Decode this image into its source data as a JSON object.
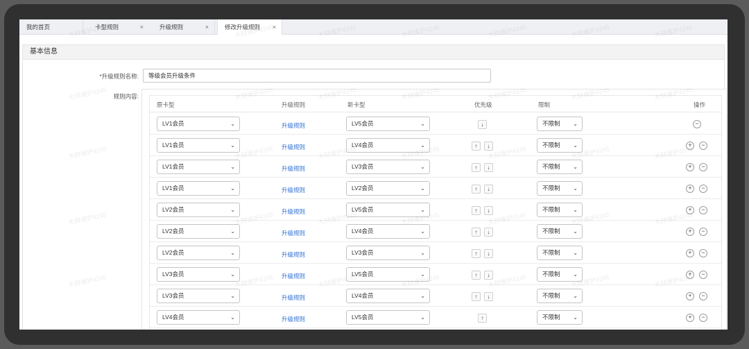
{
  "tabs": [
    {
      "label": "我的首页",
      "closable": false
    },
    {
      "label": "卡型规则",
      "closable": true
    },
    {
      "label": "升级规则",
      "closable": true
    },
    {
      "label": "修改升级规则",
      "closable": true,
      "active": true
    }
  ],
  "tab_close_glyph": "×",
  "section_title": "基本信息",
  "form": {
    "name_label": "*升级规则名称:",
    "name_value": "等级会员升级条件",
    "content_label": "规则内容:"
  },
  "table": {
    "headers": {
      "original_card": "原卡型",
      "upgrade_rule": "升级规则",
      "new_card": "新卡型",
      "priority": "优先级",
      "limit": "限制",
      "action": "操作"
    },
    "rows": [
      {
        "from": "LV1会员",
        "rule": "升级规则",
        "to": "LV5会员",
        "limit": "不限制",
        "up": false,
        "down": true,
        "add": false,
        "remove": true
      },
      {
        "from": "LV1会员",
        "rule": "升级规则",
        "to": "LV4会员",
        "limit": "不限制",
        "up": true,
        "down": true,
        "add": true,
        "remove": true
      },
      {
        "from": "LV1会员",
        "rule": "升级规则",
        "to": "LV3会员",
        "limit": "不限制",
        "up": true,
        "down": true,
        "add": true,
        "remove": true
      },
      {
        "from": "LV1会员",
        "rule": "升级规则",
        "to": "LV2会员",
        "limit": "不限制",
        "up": true,
        "down": true,
        "add": true,
        "remove": true
      },
      {
        "from": "LV2会员",
        "rule": "升级规则",
        "to": "LV5会员",
        "limit": "不限制",
        "up": true,
        "down": true,
        "add": true,
        "remove": true
      },
      {
        "from": "LV2会员",
        "rule": "升级规则",
        "to": "LV4会员",
        "limit": "不限制",
        "up": true,
        "down": true,
        "add": true,
        "remove": true
      },
      {
        "from": "LV2会员",
        "rule": "升级规则",
        "to": "LV3会员",
        "limit": "不限制",
        "up": true,
        "down": true,
        "add": true,
        "remove": true
      },
      {
        "from": "LV3会员",
        "rule": "升级规则",
        "to": "LV5会员",
        "limit": "不限制",
        "up": true,
        "down": true,
        "add": true,
        "remove": true
      },
      {
        "from": "LV3会员",
        "rule": "升级规则",
        "to": "LV4会员",
        "limit": "不限制",
        "up": true,
        "down": true,
        "add": true,
        "remove": true
      },
      {
        "from": "LV4会员",
        "rule": "升级规则",
        "to": "LV5会员",
        "limit": "不限制",
        "up": true,
        "down": false,
        "add": true,
        "remove": true
      }
    ]
  },
  "glyphs": {
    "up": "↑",
    "down": "↓",
    "add": "+",
    "remove": "−",
    "chevron": "⌄"
  },
  "watermark_text": "大财维护4245",
  "colors": {
    "link": "#2e6fd2",
    "frame": "#303030",
    "tabbar": "#eef0f3"
  }
}
